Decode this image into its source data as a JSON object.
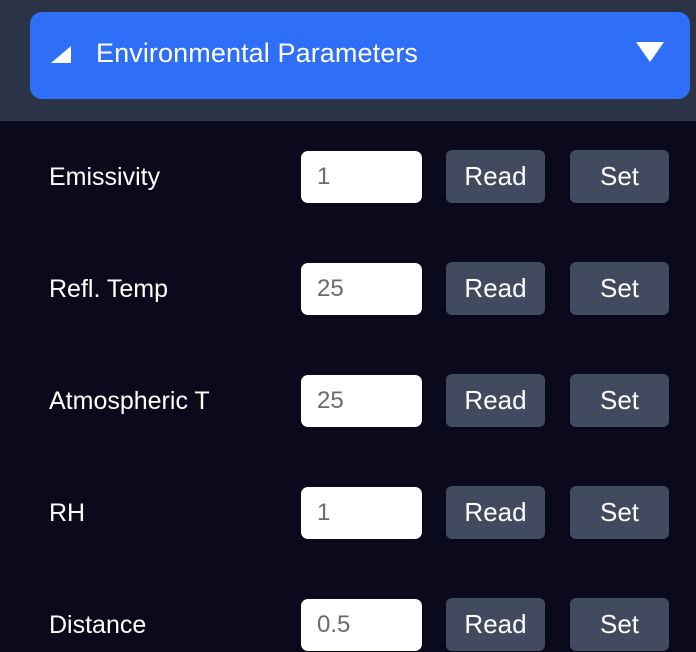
{
  "panel": {
    "title": "Environmental Parameters",
    "collapse_icon": "triangle-up-left-icon",
    "dropdown_icon": "caret-down-icon",
    "header_color": "#2f6ef7",
    "background_color": "#0a0a1c"
  },
  "rows": [
    {
      "label": "Emissivity",
      "value": "1",
      "read_label": "Read",
      "set_label": "Set"
    },
    {
      "label": "Refl. Temp",
      "value": "25",
      "read_label": "Read",
      "set_label": "Set"
    },
    {
      "label": "Atmospheric T",
      "value": "25",
      "read_label": "Read",
      "set_label": "Set"
    },
    {
      "label": "RH",
      "value": "1",
      "read_label": "Read",
      "set_label": "Set"
    },
    {
      "label": "Distance",
      "value": "0.5",
      "read_label": "Read",
      "set_label": "Set"
    }
  ]
}
